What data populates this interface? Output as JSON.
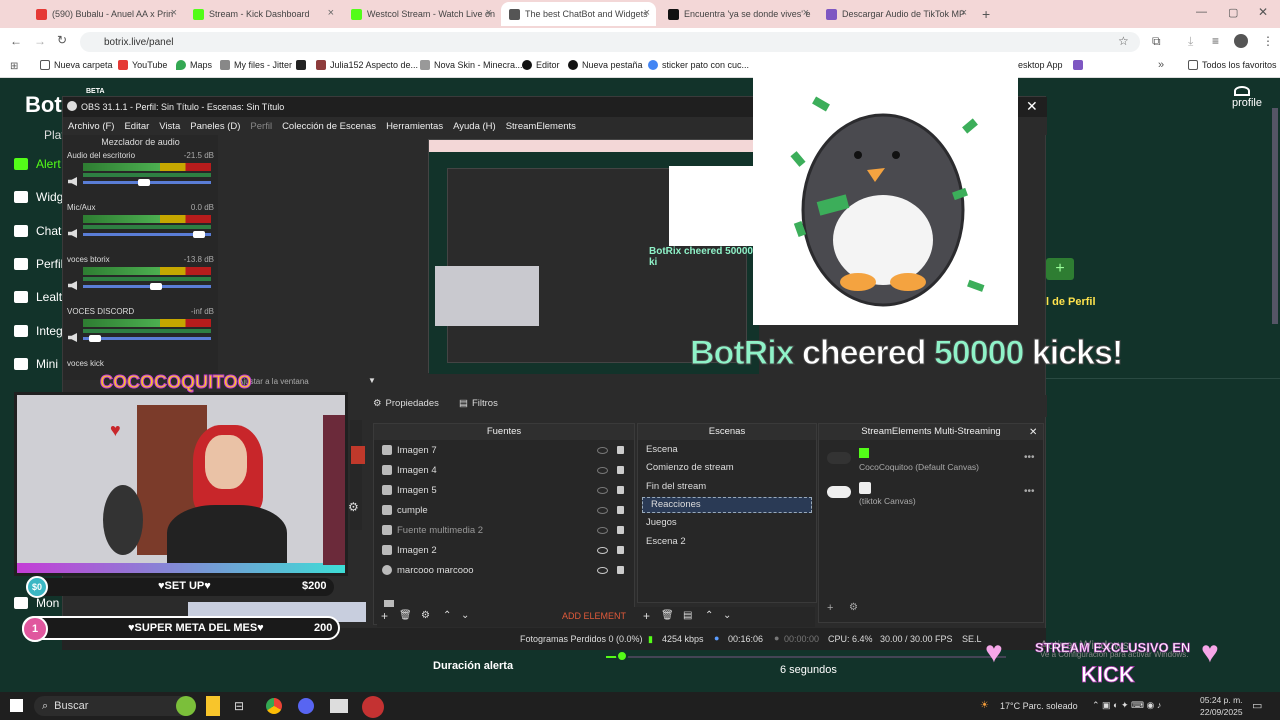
{
  "browser": {
    "tabs": [
      {
        "label": "(590) Bubalu - Anuel AA x Prin",
        "color": "#e53935"
      },
      {
        "label": "Stream - Kick Dashboard",
        "color": "#53fc18"
      },
      {
        "label": "Westcol Stream - Watch Live on",
        "color": "#53fc18"
      },
      {
        "label": "The best ChatBot and Widgets",
        "color": "#555555"
      },
      {
        "label": "Encuentra 'ya se donde vives' e",
        "color": "#111111"
      },
      {
        "label": "Descargar Audio de TikTok MP",
        "color": "#7e57c2"
      }
    ],
    "url": "botrix.live/panel",
    "bookmarks": [
      "Nueva carpeta",
      "YouTube",
      "Maps",
      "My files - Jitter",
      "Julia152 Aspecto de...",
      "Nova Skin - Minecra...",
      "Editor",
      "Nueva pestaña",
      "sticker pato con cuc...",
      "esktop App",
      "Todos los favoritos"
    ]
  },
  "page": {
    "logo": "Bot",
    "beta": "BETA",
    "sidebar": [
      "Plat",
      "Alert",
      "Widg",
      "Chat",
      "Perfil",
      "Lealt",
      "Integ",
      "Mini",
      "Mon"
    ],
    "profile": "profile",
    "perfil_link": "l de Perfil",
    "duracion_label": "Duración alerta",
    "duracion_value": "6 segundos",
    "activar_windows": "Activar Windows",
    "activar_sub": "Ve a Configuración para activar Windows."
  },
  "obs": {
    "title": "OBS 31.1.1 - Perfil: Sin Título - Escenas: Sin Título",
    "menu": [
      "Archivo (F)",
      "Editar",
      "Vista",
      "Paneles (D)",
      "Perfil",
      "Colección de Escenas",
      "Herramientas",
      "Ayuda (H)",
      "StreamElements"
    ],
    "mixer_title": "Mezclador de audio",
    "channels": [
      {
        "name": "Audio del escritorio",
        "db": "-21.5 dB",
        "level": 0.47
      },
      {
        "name": "Mic/Aux",
        "db": "0.0 dB",
        "level": 0.95
      },
      {
        "name": "voces btorix",
        "db": "-13.8 dB",
        "level": 0.58
      },
      {
        "name": "VOCES DISCORD",
        "db": "-inf dB",
        "level": 0.05
      },
      {
        "name": "voces kick",
        "db": "",
        "level": 0.5
      }
    ],
    "ajustar": "Ajustar a la ventana",
    "propiedades": "Propiedades",
    "filtros": "Filtros",
    "fuentes_title": "Fuentes",
    "fuentes": [
      "Imagen 7",
      "Imagen 4",
      "Imagen 5",
      "cumple",
      "Fuente multimedia 2",
      "Imagen 2",
      "marcooo marcooo"
    ],
    "escenas_title": "Escenas",
    "escenas": [
      "Escena",
      "Comienzo de stream",
      "Fin del stream",
      "Reacciones",
      "Juegos",
      "Escena 2"
    ],
    "selected_scene": "Reacciones",
    "multistream_title": "StreamElements Multi-Streaming",
    "multistream": [
      "CocoCoquitoo (Default Canvas)",
      "(tiktok Canvas)"
    ],
    "add_element": "ADD ELEMENT",
    "status": {
      "dropped": "Fotogramas Perdidos 0 (0.0%)",
      "kbps": "4254 kbps",
      "time1": "00:16:06",
      "time2": "00:00:00",
      "cpu": "CPU: 6.4%",
      "fps": "30.00 / 30.00 FPS",
      "sel": "SE.L"
    }
  },
  "overlay": {
    "cheer_name": "BotRix",
    "cheer_text": " cheered ",
    "cheer_amount": "50000",
    "cheer_tail": " kicks!",
    "cam_title": "COCOCOQUITOO",
    "goal1_left": "$0",
    "goal1_label": "♥SET UP♥",
    "goal1_right": "$200",
    "goal2_left": "1",
    "goal2_label": "♥SUPER META DEL MES♥",
    "goal2_right": "200",
    "stream_exclusive": "STREAM EXCLUSIVO EN",
    "kick": "KICK"
  },
  "taskbar": {
    "search": "Buscar",
    "weather": "17°C  Parc. soleado",
    "time": "05:24 p. m.",
    "date": "22/09/2025"
  }
}
